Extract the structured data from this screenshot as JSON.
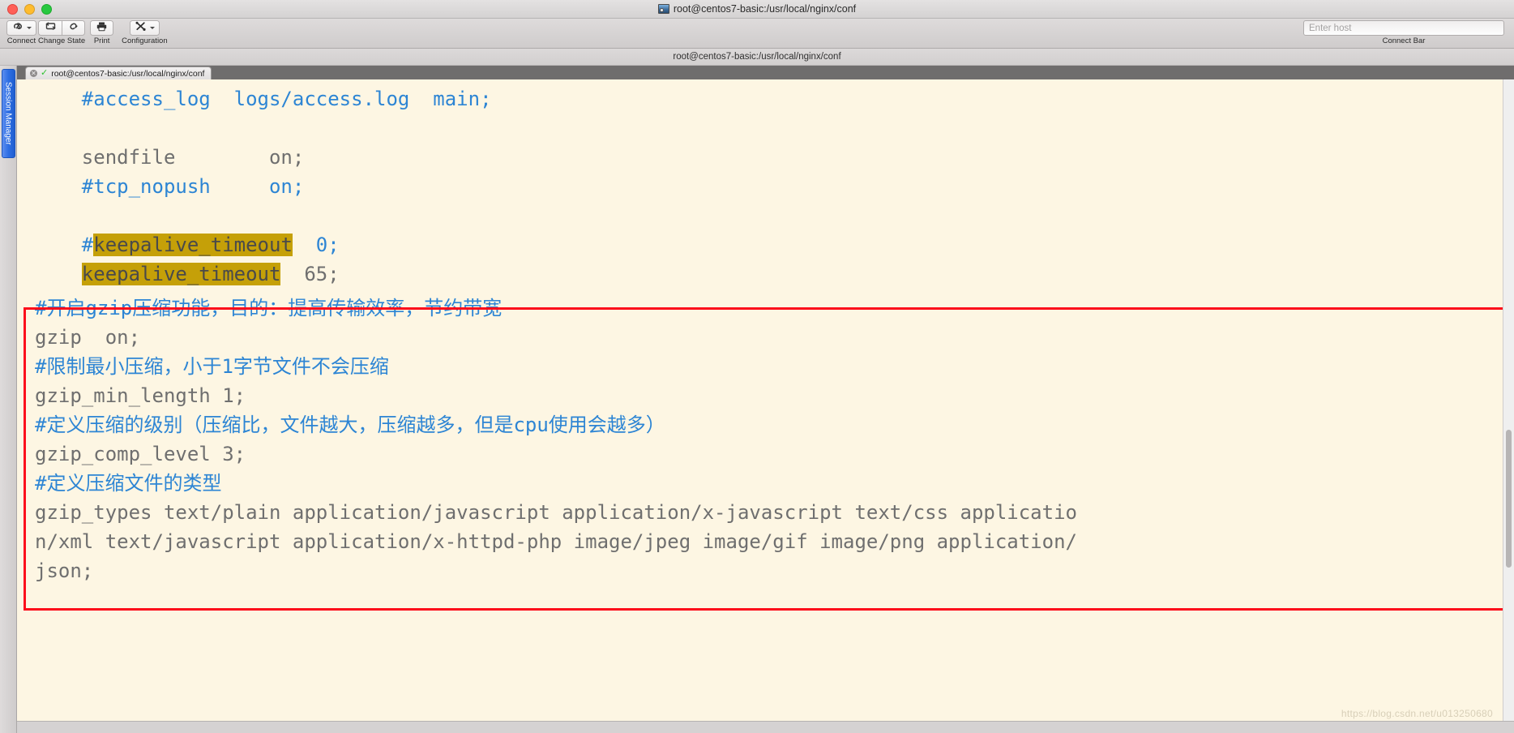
{
  "window": {
    "title": "root@centos7-basic:/usr/local/nginx/conf",
    "title_icon": "terminal-window-icon",
    "traffic_lights": [
      "close",
      "minimize",
      "maximize"
    ]
  },
  "toolbar": {
    "items": [
      {
        "label": "Connect",
        "icon": "link-icon",
        "has_caret": true
      },
      {
        "label": "Change State",
        "icon": "reconnect-icon",
        "icon2": "disconnect-icon",
        "has_caret": false
      },
      {
        "label": "Print",
        "icon": "printer-icon",
        "has_caret": false
      },
      {
        "label": "Configuration",
        "icon": "tools-icon",
        "has_caret": true
      }
    ],
    "connect_bar": {
      "label": "Connect Bar",
      "host_placeholder": "Enter host",
      "host_value": ""
    }
  },
  "subtitle": {
    "text": "root@centos7-basic:/usr/local/nginx/conf"
  },
  "sidebar": {
    "vertical_tab_label": "Session Manager"
  },
  "tabs": [
    {
      "title": "root@centos7-basic:/usr/local/nginx/conf",
      "close_icon": "close-icon",
      "status_icon": "check-icon",
      "active": true
    }
  ],
  "terminal": {
    "background": "#fdf6e3",
    "comment_color": "#2d85d4",
    "text_color": "#6f6f6f",
    "highlight_color": "#c5a008",
    "lines": [
      {
        "id": "l1",
        "segments": [
          {
            "text": "    #access_log  logs/access.log  main;",
            "style": "cmt"
          }
        ]
      },
      {
        "id": "l2",
        "segments": [
          {
            "text": " ",
            "style": "plain"
          }
        ]
      },
      {
        "id": "l3",
        "segments": [
          {
            "text": "    sendfile        on;",
            "style": "plain"
          }
        ]
      },
      {
        "id": "l4",
        "segments": [
          {
            "text": "    #tcp_nopush     on;",
            "style": "cmt"
          }
        ]
      },
      {
        "id": "l5",
        "segments": [
          {
            "text": " ",
            "style": "plain"
          }
        ]
      },
      {
        "id": "l6",
        "segments": [
          {
            "text": "    ",
            "style": "plain"
          },
          {
            "text": "#",
            "style": "cmt"
          },
          {
            "text": "keepalive_timeout",
            "style": "hl"
          },
          {
            "text": "  0;",
            "style": "cmt"
          }
        ]
      },
      {
        "id": "l7",
        "segments": [
          {
            "text": "    ",
            "style": "plain"
          },
          {
            "text": "keepalive_timeout",
            "style": "hl"
          },
          {
            "text": "  65;",
            "style": "plain"
          }
        ]
      }
    ],
    "boxed_lines": [
      {
        "id": "b1",
        "segments": [
          {
            "text": "#开启gzip压缩功能，目的：提高传输效率，节约带宽",
            "style": "cmt"
          }
        ]
      },
      {
        "id": "b2",
        "segments": [
          {
            "text": "gzip  on;",
            "style": "plain"
          }
        ]
      },
      {
        "id": "b3",
        "segments": [
          {
            "text": "#限制最小压缩，小于1字节文件不会压缩",
            "style": "cmt"
          }
        ]
      },
      {
        "id": "b4",
        "segments": [
          {
            "text": "gzip_min_length 1;",
            "style": "plain"
          }
        ]
      },
      {
        "id": "b5",
        "segments": [
          {
            "text": "#定义压缩的级别（压缩比，文件越大，压缩越多，但是cpu使用会越多）",
            "style": "cmt"
          }
        ]
      },
      {
        "id": "b6",
        "segments": [
          {
            "text": "gzip_comp_level 3;",
            "style": "plain"
          }
        ]
      },
      {
        "id": "b7",
        "segments": [
          {
            "text": "#定义压缩文件的类型",
            "style": "cmt"
          }
        ]
      },
      {
        "id": "b8",
        "segments": [
          {
            "text": "gzip_types text/plain application/javascript application/x-javascript text/css applicatio",
            "style": "plain"
          }
        ]
      },
      {
        "id": "b9",
        "segments": [
          {
            "text": "n/xml text/javascript application/x-httpd-php image/jpeg image/gif image/png application/",
            "style": "plain"
          }
        ]
      },
      {
        "id": "b10",
        "segments": [
          {
            "text": "json;",
            "style": "plain"
          }
        ]
      }
    ],
    "annotation_box_color": "#fc0d1b",
    "watermark": "https://blog.csdn.net/u013250680"
  }
}
